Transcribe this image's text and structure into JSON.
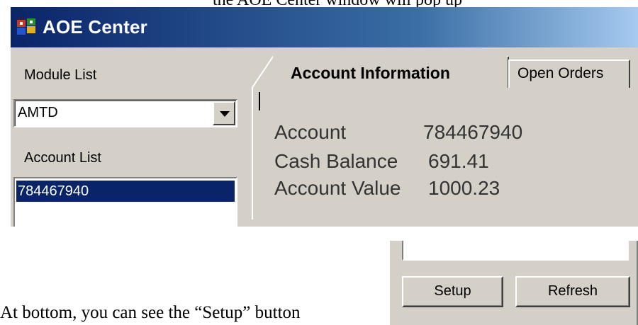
{
  "window": {
    "title": "AOE Center"
  },
  "sidebar": {
    "module_list_label": "Module List",
    "module_selected": "AMTD",
    "account_list_label": "Account List",
    "accounts": [
      "784467940"
    ]
  },
  "tabs": [
    {
      "label": "Account Information",
      "active": true
    },
    {
      "label": "Open Orders",
      "active": false
    }
  ],
  "account_info": {
    "account_label": "Account",
    "account_value": "784467940",
    "cash_label": "Cash Balance",
    "cash_value": "691.41",
    "value_label": "Account Value",
    "value_value": "1000.23"
  },
  "buttons": {
    "setup_label": "Setup",
    "refresh_label": "Refresh"
  },
  "document": {
    "caption": "At bottom, you can see the “Setup” button"
  },
  "colors": {
    "title_bar": "#0a246a",
    "window_face": "#d4d0c8",
    "selection": "#0a246a"
  }
}
